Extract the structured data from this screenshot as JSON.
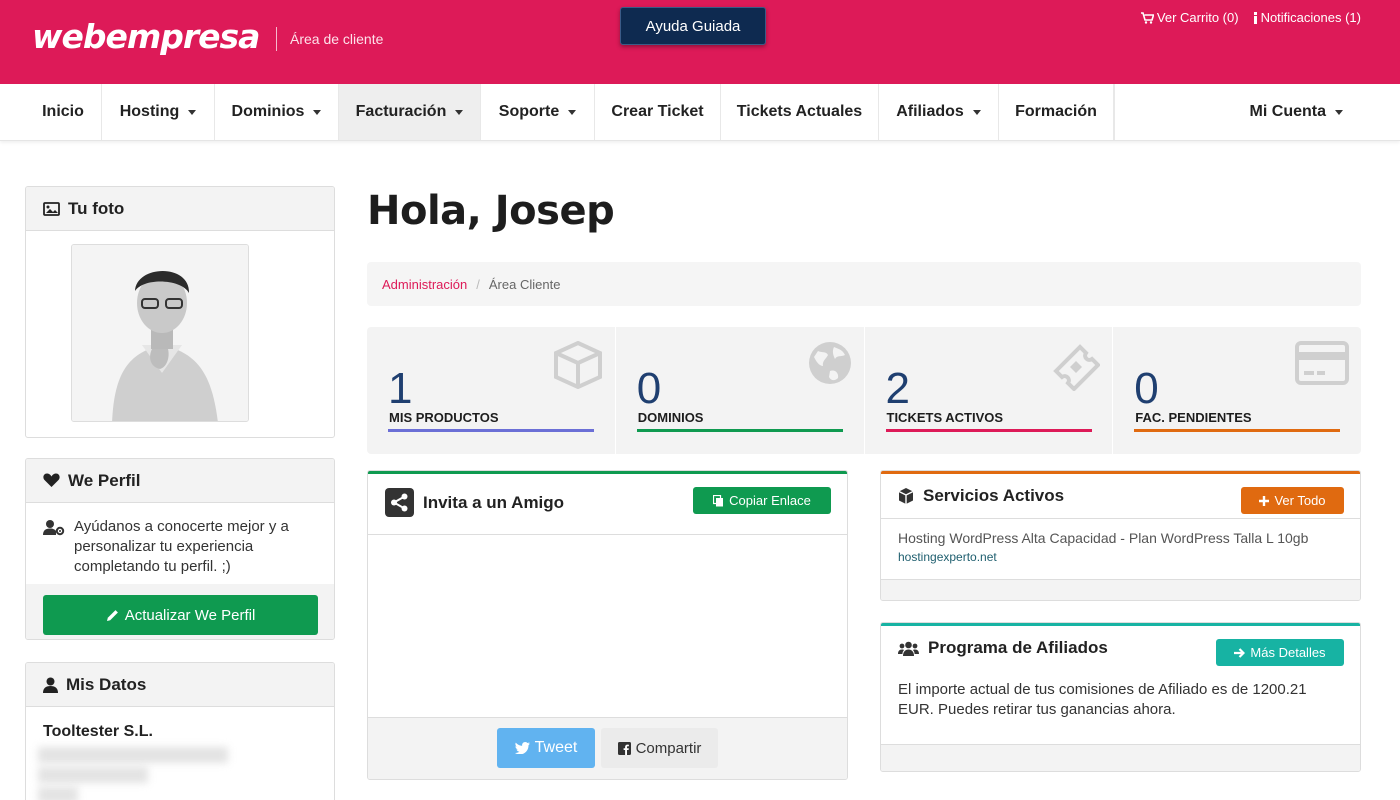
{
  "header": {
    "logo": "webempresa",
    "area_label": "Área de cliente",
    "guided_help": "Ayuda Guiada",
    "cart_label": "Ver Carrito (0)",
    "notifications_label": "Notificaciones (1)",
    "brand_color": "#dd1a58"
  },
  "nav": {
    "items": [
      {
        "label": "Inicio",
        "dropdown": false
      },
      {
        "label": "Hosting",
        "dropdown": true
      },
      {
        "label": "Dominios",
        "dropdown": true
      },
      {
        "label": "Facturación",
        "dropdown": true,
        "active": true
      },
      {
        "label": "Soporte",
        "dropdown": true
      },
      {
        "label": "Crear Ticket",
        "dropdown": false
      },
      {
        "label": "Tickets Actuales",
        "dropdown": false
      },
      {
        "label": "Afiliados",
        "dropdown": true
      },
      {
        "label": "Formación",
        "dropdown": false
      }
    ],
    "account": "Mi Cuenta"
  },
  "sidebar": {
    "photo_title": "Tu foto",
    "profile_title": "We Perfil",
    "profile_text": "Ayúdanos a conocerte mejor y a personalizar tu experiencia completando tu perfil. ;)",
    "profile_button": "Actualizar We Perfil",
    "data_title": "Mis Datos",
    "company": "Tooltester S.L."
  },
  "main": {
    "greeting": "Hola, Josep",
    "breadcrumb": {
      "link": "Administración",
      "separator": "/",
      "current": "Área Cliente"
    },
    "stats": [
      {
        "value": "1",
        "label": "MIS PRODUCTOS",
        "color": "#6b6fd6",
        "icon": "box-icon"
      },
      {
        "value": "0",
        "label": "DOMINIOS",
        "color": "#0f9a50",
        "icon": "globe-icon"
      },
      {
        "value": "2",
        "label": "TICKETS ACTIVOS",
        "color": "#dd1a58",
        "icon": "ticket-icon"
      },
      {
        "value": "0",
        "label": "FAC. PENDIENTES",
        "color": "#e06a10",
        "icon": "credit-card-icon"
      }
    ],
    "invite": {
      "title": "Invita a un Amigo",
      "copy_button": "Copiar Enlace",
      "tweet_button": "Tweet",
      "share_button": "Compartir",
      "accent": "#0f9a50"
    },
    "services": {
      "title": "Servicios Activos",
      "button": "Ver Todo",
      "line": "Hosting WordPress Alta Capacidad - Plan WordPress Talla L 10gb",
      "domain": "hostingexperto.net",
      "accent": "#e06a10"
    },
    "affiliates": {
      "title": "Programa de Afiliados",
      "button": "Más Detalles",
      "text": "El importe actual de tus comisiones de Afiliado es de 1200.21 EUR. Puedes retirar tus ganancias ahora.",
      "accent": "#17b3a3"
    }
  }
}
